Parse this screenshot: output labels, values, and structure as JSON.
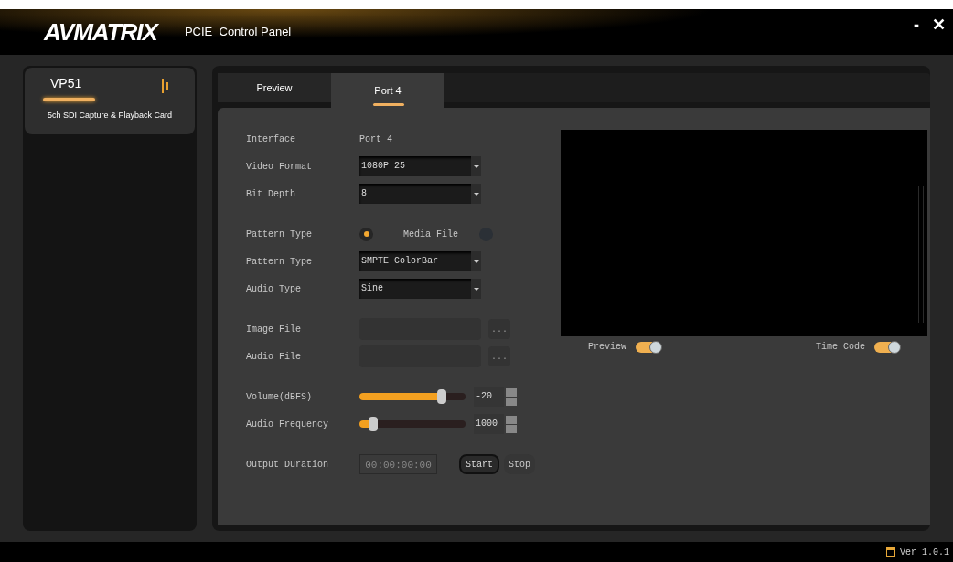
{
  "window": {
    "logo": "AVMATRIX",
    "title": "PCIE  Control Panel",
    "controls": [
      "-",
      "✕"
    ]
  },
  "sidebar": {
    "cards": [
      {
        "name": "VP51",
        "subtitle": "5ch SDI Capture & Playback Card",
        "selected": true
      }
    ]
  },
  "tabs": [
    {
      "label": "Preview",
      "selected": false
    },
    {
      "label": "Port 4",
      "selected": true
    }
  ],
  "form": {
    "groups": [
      [
        {
          "kind": "text",
          "label": "Interface",
          "value": "Port 4"
        },
        {
          "kind": "select",
          "label": "Video Format",
          "value": "1080P 25"
        },
        {
          "kind": "select",
          "label": "Bit Depth",
          "value": "8"
        }
      ],
      [
        {
          "kind": "radio",
          "label": "Pattern Type",
          "options": [
            {
              "selected": true
            },
            {
              "label": "Media File",
              "selected": false
            }
          ]
        },
        {
          "kind": "select",
          "label": "Pattern Type",
          "value": "SMPTE ColorBar"
        },
        {
          "kind": "select",
          "label": "Audio Type",
          "value": "Sine"
        }
      ],
      [
        {
          "kind": "file",
          "label": "Image File",
          "button": "..."
        },
        {
          "kind": "file",
          "label": "Audio File",
          "button": "..."
        }
      ],
      [
        {
          "kind": "slider",
          "label": "Volume(dBFS)",
          "level": 0.78,
          "value": "-20"
        },
        {
          "kind": "slider",
          "label": "Audio Frequency",
          "level": 0.13,
          "value": "1000"
        }
      ],
      [
        {
          "kind": "timecode",
          "label": "Output Duration",
          "value": "00:00:00:00",
          "buttons": [
            {
              "label": "Start",
              "selected": true
            },
            {
              "label": "Stop",
              "selected": false
            }
          ]
        }
      ]
    ]
  },
  "preview": {
    "toggles": [
      {
        "label": "Preview",
        "on": true
      },
      {
        "label": "Time Code",
        "on": true
      }
    ]
  },
  "status_bar": {
    "version": "Ver 1.0.1"
  }
}
